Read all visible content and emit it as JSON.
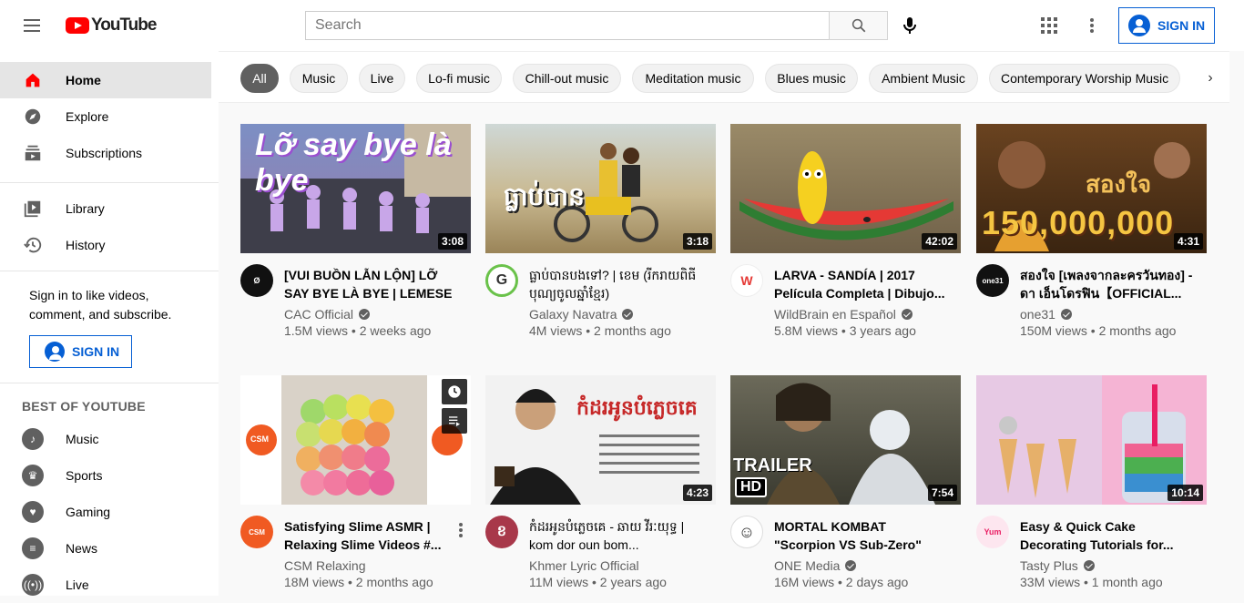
{
  "header": {
    "logo_text": "YouTube",
    "search_placeholder": "Search",
    "signin_label": "SIGN IN"
  },
  "sidebar": {
    "items": [
      {
        "label": "Home",
        "icon": "home-icon"
      },
      {
        "label": "Explore",
        "icon": "compass-icon"
      },
      {
        "label": "Subscriptions",
        "icon": "subscriptions-icon"
      },
      {
        "label": "Library",
        "icon": "library-icon"
      },
      {
        "label": "History",
        "icon": "history-icon"
      }
    ],
    "sign_prompt": "Sign in to like videos, comment, and subscribe.",
    "signin_label": "SIGN IN",
    "best_heading": "BEST OF YOUTUBE",
    "best_items": [
      {
        "label": "Music",
        "icon": "music-icon"
      },
      {
        "label": "Sports",
        "icon": "trophy-icon"
      },
      {
        "label": "Gaming",
        "icon": "gaming-icon"
      },
      {
        "label": "News",
        "icon": "news-icon"
      },
      {
        "label": "Live",
        "icon": "live-icon"
      }
    ]
  },
  "chips": [
    "All",
    "Music",
    "Live",
    "Lo-fi music",
    "Chill-out music",
    "Meditation music",
    "Blues music",
    "Ambient Music",
    "Contemporary Worship Music"
  ],
  "videos": [
    {
      "title": "[VUI BUỒN LẪN LỘN] LỠ SAY BYE LÀ BYE | LEMESE ...",
      "channel": "CAC Official",
      "stats": "1.5M views • 2 weeks ago",
      "duration": "3:08",
      "thumb_text": "Lỡ say bye là bye",
      "avatar_text": "Ø",
      "colors": {
        "bg": "#6a7fb0",
        "avatar": "#111111"
      }
    },
    {
      "title": "ធ្លាប់បានបងទៅ? | ខេម (រីករាយពិធីបុណ្យចូលឆ្នាំខ្មែរ)",
      "channel": "Galaxy Navatra",
      "stats": "4M views • 2 months ago",
      "duration": "3:18",
      "thumb_text": "ធ្លាប់បាន",
      "avatar_text": "G",
      "colors": {
        "bg": "#b9a77a",
        "avatar": "#ffffff"
      }
    },
    {
      "title": "LARVA - SANDÍA | 2017 Película Completa | Dibujo...",
      "channel": "WildBrain en Español",
      "stats": "5.8M views • 3 years ago",
      "duration": "42:02",
      "thumb_text": "",
      "avatar_text": "W",
      "colors": {
        "bg": "#8b7a5a",
        "avatar": "#ffffff"
      }
    },
    {
      "title": "สองใจ [เพลงจากละครวันทอง] - ดา เอ็นโดรฟิน【OFFICIAL...",
      "channel": "one31",
      "stats": "150M views • 2 months ago",
      "duration": "4:31",
      "thumb_text": "150,000,000",
      "avatar_text": "one31",
      "colors": {
        "bg": "#5a3a1a",
        "avatar": "#111111"
      }
    },
    {
      "title": "Satisfying Slime ASMR | Relaxing Slime Videos #...",
      "channel": "CSM Relaxing",
      "stats": "18M views • 2 months ago",
      "duration": "",
      "thumb_text": "CSM",
      "avatar_text": "CSM",
      "colors": {
        "bg": "#ffffff",
        "avatar": "#f05a22"
      }
    },
    {
      "title": "កំដរអូនបំភ្លេចគេ - ឆាយ វីរៈយុទ្ធ | kom dor oun bom...",
      "channel": "Khmer Lyric Official",
      "stats": "11M views • 2 years ago",
      "duration": "4:23",
      "thumb_text": "កំដរអូនបំភ្លេចគេ",
      "avatar_text": "ខ",
      "colors": {
        "bg": "#e8e8e8",
        "avatar": "#a8384a"
      }
    },
    {
      "title": "MORTAL KOMBAT \"Scorpion VS Sub-Zero\" Opening Sce...",
      "channel": "ONE Media",
      "stats": "16M views • 2 days ago",
      "duration": "7:54",
      "thumb_text": "TRAILER",
      "thumb_badge": "HD",
      "avatar_text": "☺",
      "colors": {
        "bg": "#4a4a3a",
        "avatar": "#ffffff"
      }
    },
    {
      "title": "Easy & Quick Cake Decorating Tutorials for...",
      "channel": "Tasty Plus",
      "stats": "33M views • 1 month ago",
      "duration": "10:14",
      "thumb_text": "",
      "avatar_text": "Yum",
      "colors": {
        "bg": "#f2a7c8",
        "avatar": "#fde6ef"
      }
    }
  ]
}
